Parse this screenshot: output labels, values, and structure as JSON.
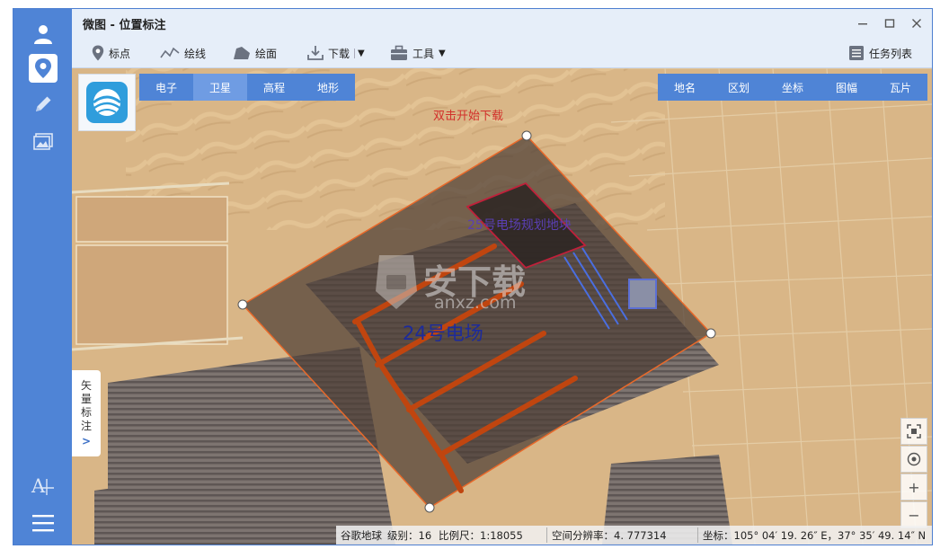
{
  "window": {
    "title": "微图 - 位置标注"
  },
  "toolbar": {
    "mark_point": "标点",
    "draw_line": "绘线",
    "draw_area": "绘面",
    "download": "下载",
    "tools": "工具",
    "task_list": "任务列表"
  },
  "map_types": [
    "电子",
    "卫星",
    "高程",
    "地形"
  ],
  "map_types_active": "卫星",
  "overlays": [
    "地名",
    "区划",
    "坐标",
    "图幅",
    "瓦片"
  ],
  "map": {
    "download_hint": "双击开始下载",
    "plot_label": "25号电场规划地块",
    "field_label": "24号电场",
    "watermark_main": "安下载",
    "watermark_url": "anxz.com"
  },
  "side_panel": {
    "label_chars": [
      "矢",
      "量",
      "标",
      "注"
    ],
    "expand": ">"
  },
  "status": {
    "source": "谷歌地球",
    "level": "级别：16",
    "scale": "比例尺：1:18055",
    "resolution": "空间分辨率：4. 777314",
    "coordinates": "坐标：105° 04′ 19. 26″ E，37° 35′ 49. 14″ N"
  },
  "colors": {
    "accent": "#4f84d6",
    "polygon_stroke": "#e8692a",
    "plot_stroke": "#c0203a",
    "road": "#c0450f",
    "hint": "#d2302b",
    "field_label": "#1d2b9a",
    "plot_label": "#5a3fb3"
  }
}
